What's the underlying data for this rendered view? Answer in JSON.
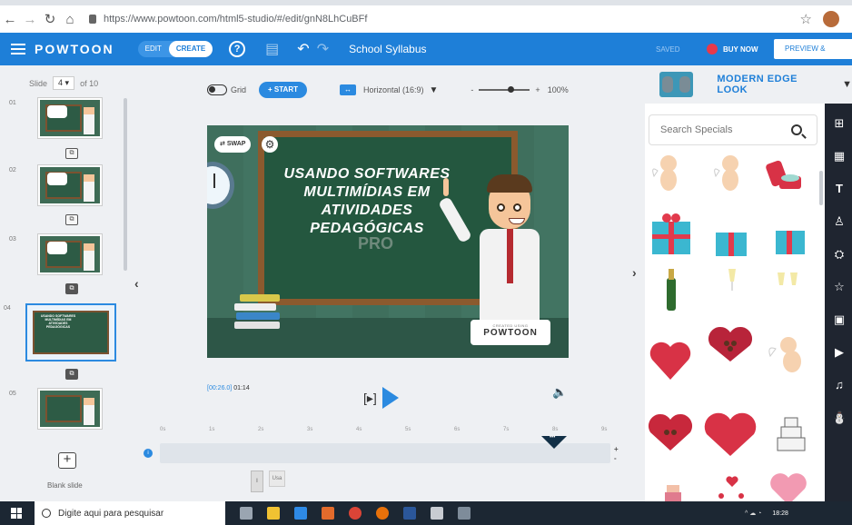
{
  "browser": {
    "url": "https://www.powtoon.com/html5-studio/#/edit/gnN8LhCuBFf"
  },
  "app": {
    "logo": "POWTOON",
    "mode_edit": "EDIT",
    "mode_create": "CREATE",
    "help": "?",
    "project_title": "School Syllabus",
    "saved": "SAVED",
    "buy_now": "BUY NOW",
    "preview_export": "PREVIEW & EXPORT"
  },
  "slides": {
    "label": "Slide",
    "current": "4",
    "total_label": "of 10",
    "numbers": [
      "01",
      "02",
      "03",
      "04",
      "05"
    ],
    "selected_title": "USANDO SOFTWARES MULTIMÍDIAS EM ATIVIDADES PEDAGÓGICAS",
    "blank_slide": "Blank slide"
  },
  "toolbar": {
    "grid": "Grid",
    "start": "+ START",
    "orientation": "Horizontal (16:9)",
    "zoom_minus": "-",
    "zoom_plus": "+",
    "zoom_level": "100%"
  },
  "stage": {
    "swap": "SWAP",
    "title_lines": [
      "USANDO SOFTWARES",
      "MULTIMÍDIAS EM ATIVIDADES",
      "PEDAGÓGICAS"
    ],
    "pro": "PRO",
    "created_using": "CREATED USING",
    "brand": "POWTOON"
  },
  "playback": {
    "elapsed": "[00:26.0]",
    "duration": "01:14",
    "bracket_play": "[▸]"
  },
  "timeline": {
    "ticks": [
      "0s",
      "1s",
      "2s",
      "3s",
      "4s",
      "5s",
      "6s",
      "7s",
      "8s",
      "9s"
    ],
    "playhead_position_s": 8,
    "layer_chip_1": "I",
    "layer_chip_2": "Usa"
  },
  "right_panel": {
    "style_name": "MODERN EDGE LOOK",
    "search_placeholder": "Search Specials",
    "specials": [
      "cupid-icon",
      "cupid-icon",
      "ring-box-icon",
      "gift-box-icon",
      "gift-box-icon",
      "gift-box-icon",
      "champagne-bottle-icon",
      "champagne-glass-icon",
      "champagne-glasses-icon",
      "heart-icon",
      "chocolate-box-icon",
      "cupid-icon",
      "chocolate-box-icon",
      "heart-box-icon",
      "wedding-cake-icon",
      "cake-icon",
      "hearts-icon",
      "heart-icon"
    ],
    "sidebar_icons": [
      "layout-icon",
      "background-icon",
      "text-icon",
      "character-icon",
      "props-icon",
      "shapes-icon",
      "media-icon",
      "video-icon",
      "music-icon",
      "specials-icon"
    ]
  },
  "taskbar": {
    "search": "Digite aqui para pesquisar",
    "time": "18:28"
  },
  "colors": {
    "brand_blue": "#1e7fd8",
    "board_green": "#24573f",
    "buy_red": "#e8394a"
  }
}
